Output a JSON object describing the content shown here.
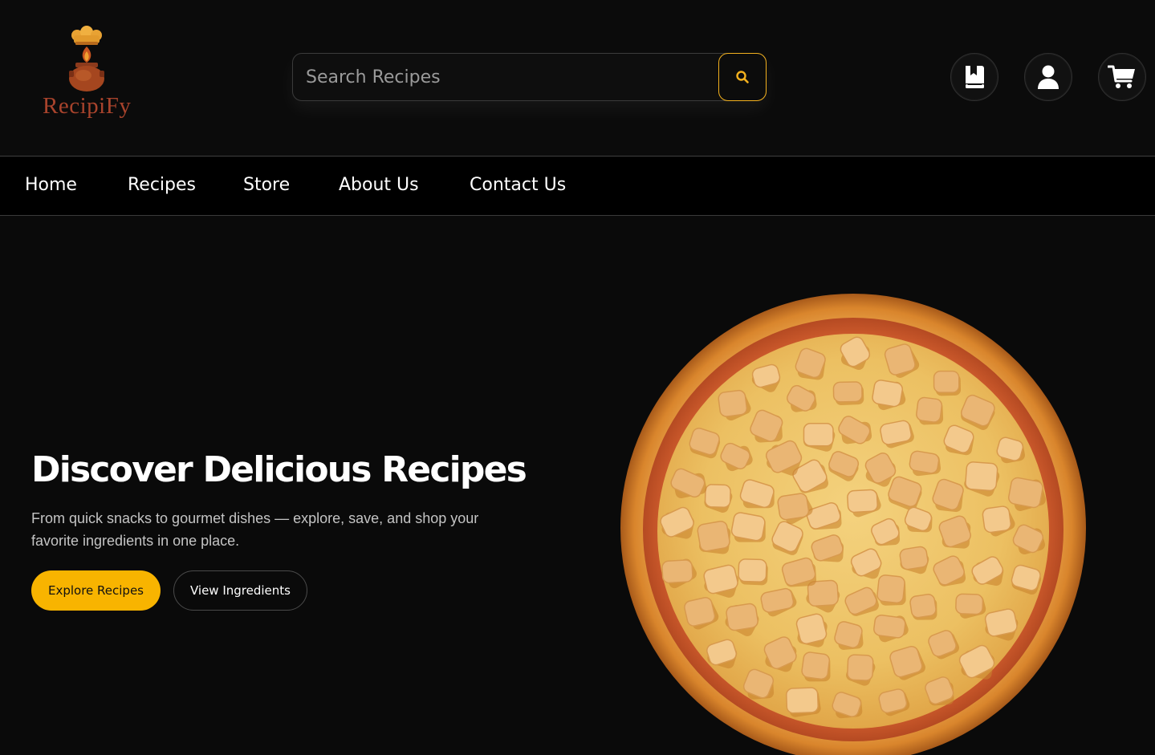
{
  "brand": {
    "name": "RecipiFy",
    "logo_icon": "chef-pot-logo"
  },
  "search": {
    "placeholder": "Search Recipes",
    "icon": "search-icon"
  },
  "header_icons": [
    "bookmark-icon",
    "user-icon",
    "cart-icon"
  ],
  "nav": {
    "items": [
      {
        "label": "Home"
      },
      {
        "label": "Recipes"
      },
      {
        "label": "Store"
      },
      {
        "label": "About Us"
      },
      {
        "label": "Contact Us"
      }
    ]
  },
  "hero": {
    "title": "Discover Delicious Recipes",
    "subtitle": "From quick snacks to gourmet dishes — explore, save, and shop your favorite ingredients in one place.",
    "primary_button": "Explore Recipes",
    "secondary_button": "View Ingredients",
    "image": "pizza-image"
  },
  "colors": {
    "background": "#0a0a0a",
    "accent": "#f8b400",
    "brand_text": "#a8432c"
  }
}
